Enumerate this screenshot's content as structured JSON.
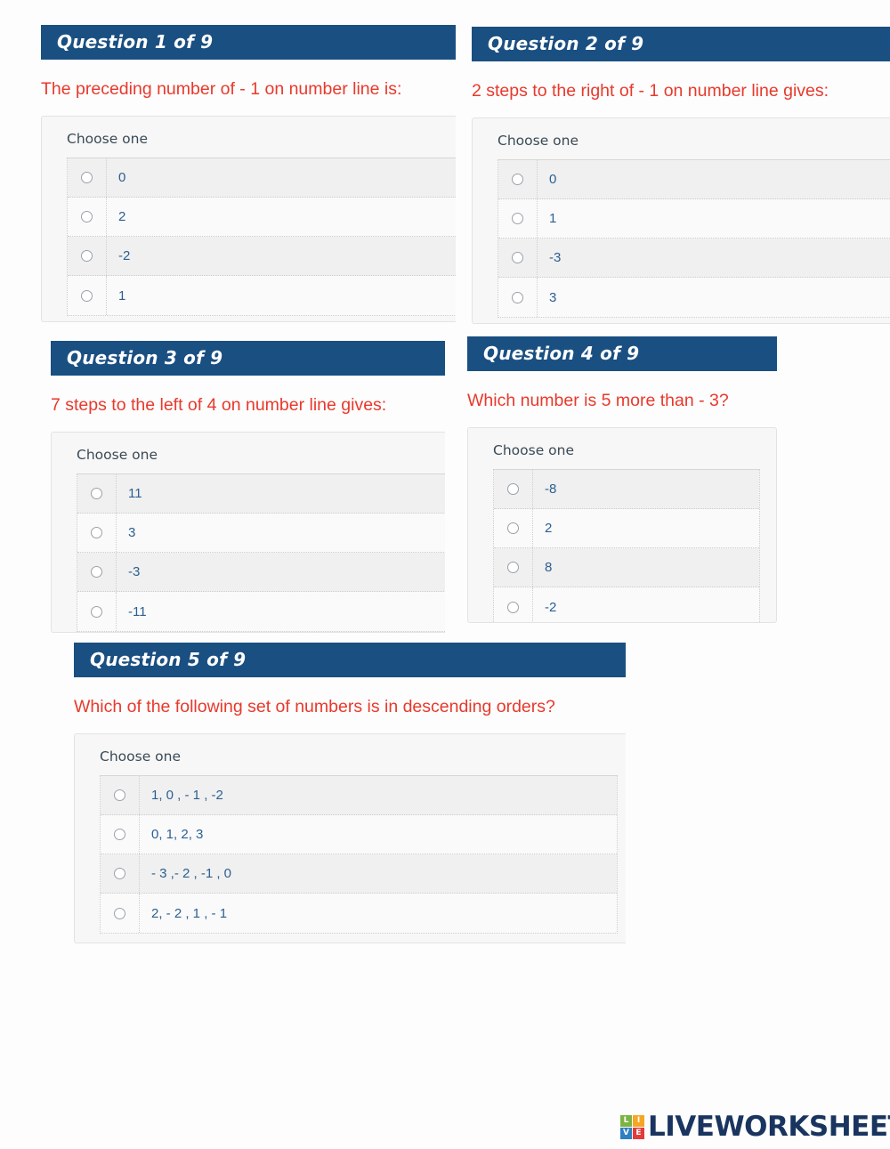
{
  "theme": {
    "header_bg": "#1a4f81",
    "question_text_color": "#e8392c",
    "option_text_color": "#2b5f91",
    "option_box_bg": "#f7f7f7",
    "logo_word_color": "#19355f"
  },
  "choose_one_label": "Choose one",
  "questions": [
    {
      "header": "Question 1 of 9",
      "prompt": "The preceding number of - 1 on number line is:",
      "options": [
        "0",
        "2",
        "-2",
        "1"
      ]
    },
    {
      "header": "Question 2 of 9",
      "prompt": "2 steps to the right of - 1 on number line gives:",
      "options": [
        "0",
        "1",
        "-3",
        "3"
      ]
    },
    {
      "header": "Question 3 of 9",
      "prompt": "7 steps to the left of 4 on number line gives:",
      "options": [
        "11",
        "3",
        "-3",
        "-11"
      ]
    },
    {
      "header": "Question 4 of 9",
      "prompt": "Which number is 5 more than - 3?",
      "options": [
        "-8",
        "2",
        "8",
        "-2"
      ]
    },
    {
      "header": "Question 5 of 9",
      "prompt": "Which of the following set of numbers is in descending orders?",
      "options": [
        "1, 0 , - 1 , -2",
        "0, 1, 2, 3",
        "- 3 ,- 2 , -1 , 0",
        "2, - 2 , 1 , - 1"
      ]
    }
  ],
  "footer": {
    "logo_blocks": [
      "L",
      "I",
      "V",
      "E"
    ],
    "logo_word": "LIVEWORKSHEETS"
  }
}
